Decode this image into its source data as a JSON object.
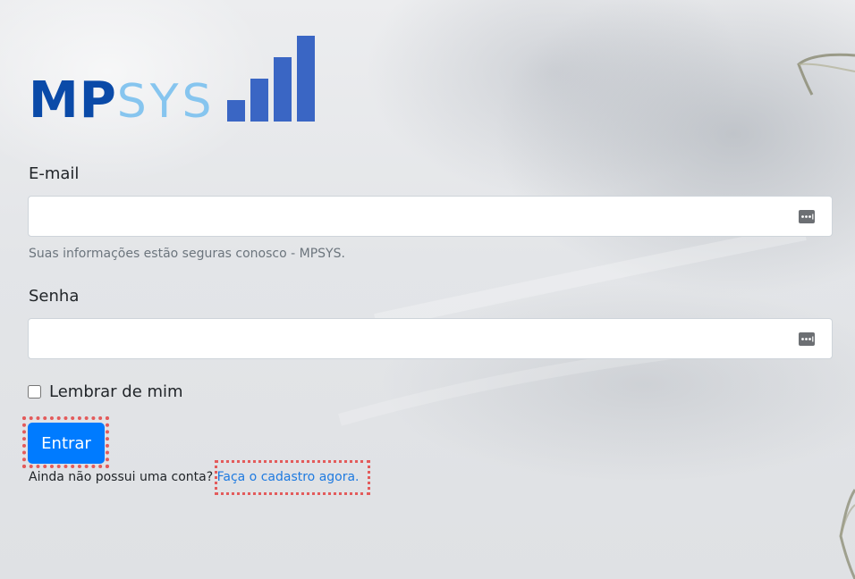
{
  "logo": {
    "part1": "MP",
    "part2": "SYS"
  },
  "form": {
    "email": {
      "label": "E-mail",
      "value": "",
      "placeholder": "",
      "help": "Suas informações estão seguras conosco - MPSYS."
    },
    "password": {
      "label": "Senha",
      "value": "",
      "placeholder": ""
    },
    "remember": {
      "label": "Lembrar de mim",
      "checked": false
    },
    "submit_label": "Entrar",
    "signup_prompt": "Ainda não possui uma conta?",
    "signup_link": "Faça o cadastro agora."
  },
  "colors": {
    "logo_dark": "#0a4aa8",
    "logo_light": "#86c5ef",
    "logo_bars": "#3a66c4",
    "button": "#007bff",
    "link": "#1f7ae0",
    "highlight": "#e35b5b"
  },
  "icons": [
    "password-manager-icon"
  ]
}
